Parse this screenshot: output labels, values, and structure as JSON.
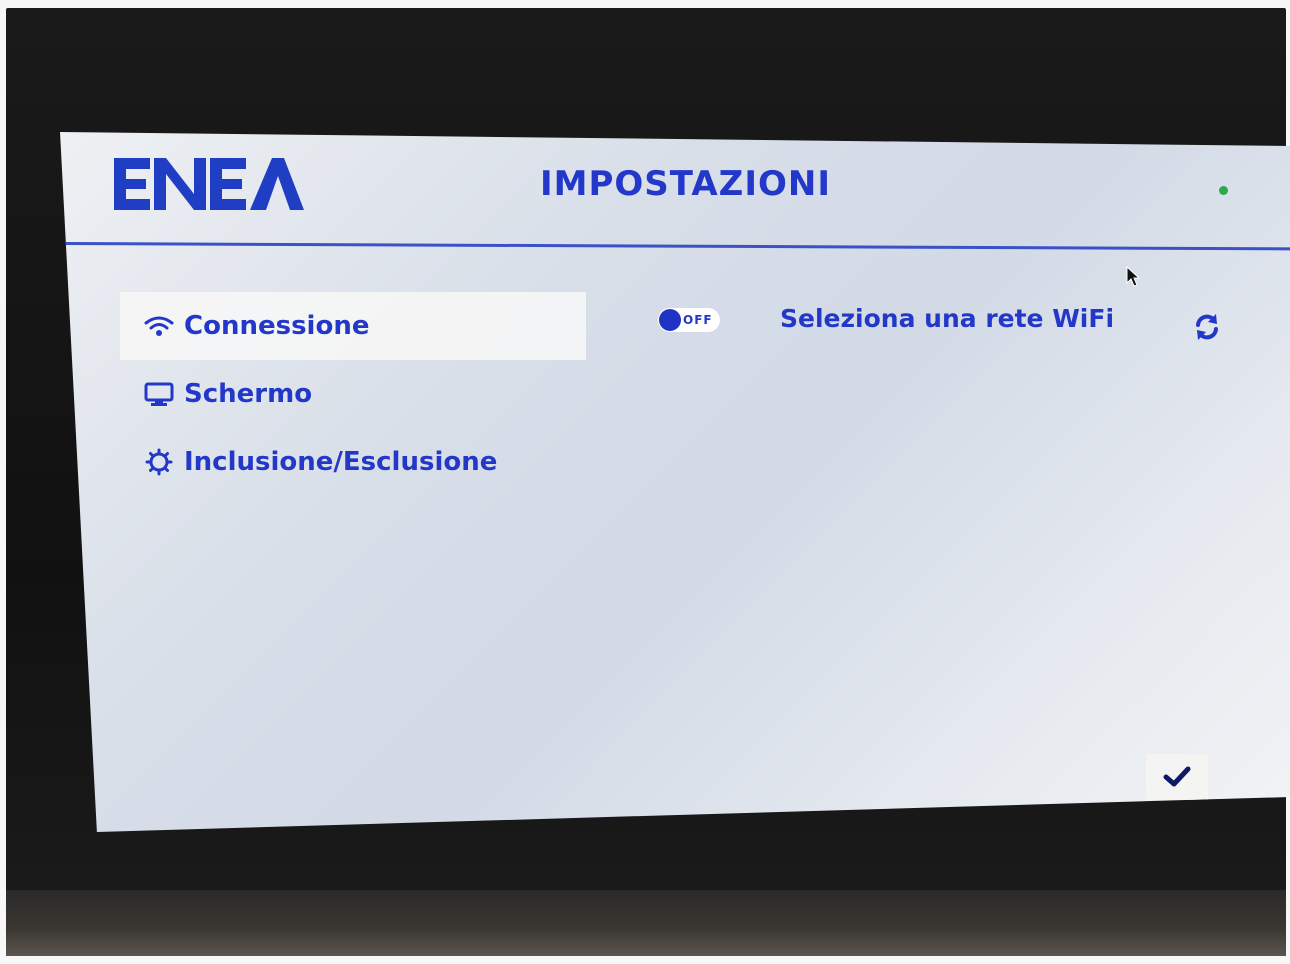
{
  "header": {
    "logo_text": "ENEA",
    "title": "IMPOSTAZIONI",
    "status_indicator_color": "#2ea84a"
  },
  "sidebar": {
    "items": [
      {
        "label": "Connessione",
        "icon": "wifi-icon",
        "selected": true
      },
      {
        "label": "Schermo",
        "icon": "monitor-icon",
        "selected": false
      },
      {
        "label": "Inclusione/Esclusione",
        "icon": "gear-icon",
        "selected": false
      }
    ]
  },
  "connection": {
    "wifi_toggle_label": "OFF",
    "wifi_toggle_state": "off",
    "network_prompt": "Seleziona una rete WiFi",
    "refresh_icon": "refresh-icon"
  },
  "footer": {
    "confirm_icon": "checkmark-icon"
  },
  "colors": {
    "accent": "#2338c9",
    "header_line": "#3a52c6",
    "status_green": "#2ea84a"
  }
}
